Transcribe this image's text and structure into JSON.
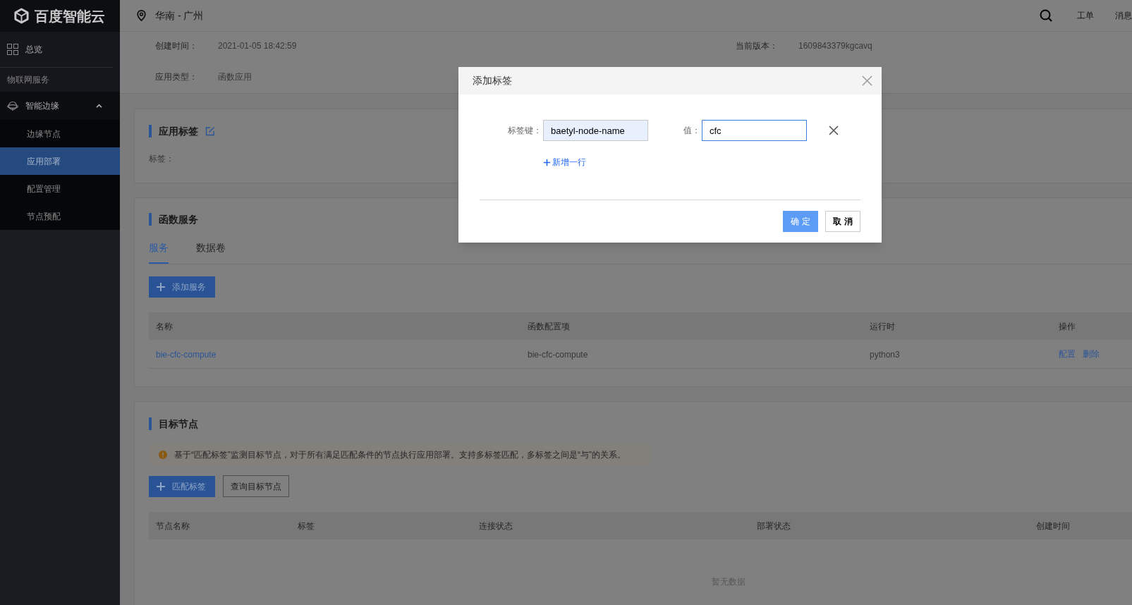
{
  "header": {
    "logo": "百度智能云",
    "region": "华南 - 广州",
    "links": [
      "工单",
      "消息"
    ]
  },
  "sidebar": {
    "items": [
      {
        "kind": "link",
        "label": "总览",
        "selected": false
      },
      {
        "kind": "heading",
        "label": "物联网服务"
      },
      {
        "kind": "group",
        "label": "智能边缘",
        "expanded": true,
        "children": [
          {
            "label": "边缘节点",
            "selected": false
          },
          {
            "label": "应用部署",
            "selected": true
          },
          {
            "label": "配置管理",
            "selected": false
          },
          {
            "label": "节点预配",
            "selected": false
          }
        ]
      }
    ]
  },
  "info": {
    "rows": [
      [
        {
          "label": "创建时间：",
          "value": "2021-01-05 18:42:59"
        },
        {
          "label": "当前版本：",
          "value": "1609843379kgcavq"
        }
      ],
      [
        {
          "label": "应用类型：",
          "value": "函数应用"
        }
      ]
    ]
  },
  "tags_panel": {
    "title": "应用标签",
    "field_label": "标签："
  },
  "function_panel": {
    "title": "函数服务",
    "tabs": [
      {
        "label": "服务",
        "selected": true
      },
      {
        "label": "数据卷",
        "selected": false
      }
    ],
    "buttons": [
      {
        "kind": "primary",
        "label": "添加服务"
      }
    ],
    "table": {
      "columns": [
        "名称",
        "函数配置项",
        "运行时",
        "操作"
      ],
      "rows": [
        {
          "name": "bie-cfc-compute",
          "config": "bie-cfc-compute",
          "runtime": "python3",
          "actions": [
            "配置",
            "删除"
          ]
        }
      ]
    }
  },
  "target_panel": {
    "title": "目标节点",
    "notice": "基于“匹配标签”监测目标节点，对于所有满足匹配条件的节点执行应用部署。支持多标签匹配，多标签之间是“与”的关系。",
    "buttons": [
      {
        "kind": "primary",
        "label": "匹配标签"
      },
      {
        "kind": "default",
        "label": "查询目标节点"
      }
    ],
    "table": {
      "columns": [
        "节点名称",
        "标签",
        "连接状态",
        "部署状态",
        "创建时间"
      ],
      "empty_text": "暂无数据"
    }
  },
  "dialog": {
    "title": "添加标签",
    "rows": [
      {
        "key_label": "标签键：",
        "key": {
          "value": "baetyl-node-name",
          "focused": false
        },
        "value_label": "值：",
        "value": {
          "value": "cfc",
          "focused": true
        }
      }
    ],
    "add_row": "新增一行",
    "buttons": [
      {
        "kind": "primary",
        "label": "确 定"
      },
      {
        "kind": "default",
        "label": "取 消"
      }
    ]
  }
}
